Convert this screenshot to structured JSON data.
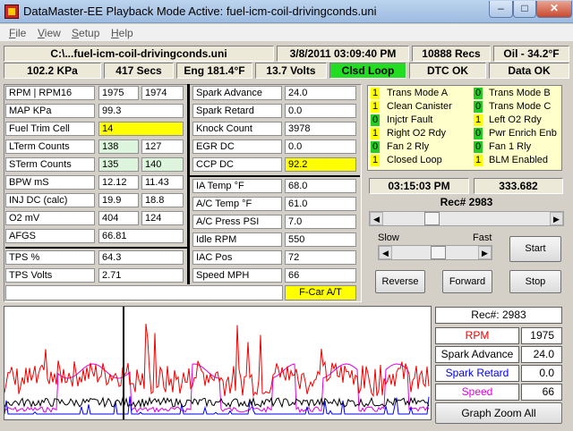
{
  "window": {
    "title": "DataMaster-EE  Playback Mode Active: fuel-icm-coil-drivingconds.uni"
  },
  "menu": [
    "File",
    "View",
    "Setup",
    "Help"
  ],
  "status_row1": {
    "file": "C:\\...fuel-icm-coil-drivingconds.uni",
    "datetime": "3/8/2011   03:09:40 PM",
    "records": "10888 Recs",
    "oil": "Oil - 34.2°F"
  },
  "status_row2": {
    "kpa": "102.2 KPa",
    "secs": "417 Secs",
    "eng": "Eng  181.4°F",
    "volts": "13.7 Volts",
    "loop": "Clsd Loop",
    "dtc": "DTC OK",
    "data": "Data OK"
  },
  "left_rows": [
    {
      "label": "RPM   |  RPM16",
      "v1": "1975",
      "v2": "1974",
      "v1_color": "white",
      "v2_color": "white"
    },
    {
      "label": "MAP KPa",
      "v1": "99.3",
      "v2": "",
      "v1_color": "white"
    },
    {
      "label": "Fuel Trim Cell",
      "v1": "14",
      "v2": "",
      "v1_color": "yellow"
    },
    {
      "label": "LTerm Counts",
      "v1": "138",
      "v2": "127",
      "v1_color": "lgreen",
      "v2_color": "white"
    },
    {
      "label": "STerm Counts",
      "v1": "135",
      "v2": "140",
      "v1_color": "lgreen",
      "v2_color": "lgreen"
    },
    {
      "label": "BPW  mS",
      "v1": "12.12",
      "v2": "11.43",
      "v1_color": "white",
      "v2_color": "white"
    },
    {
      "label": "INJ DC (calc)",
      "v1": "19.9",
      "v2": "18.8",
      "v1_color": "white",
      "v2_color": "white"
    },
    {
      "label": "O2 mV",
      "v1": "404",
      "v2": "124",
      "v1_color": "white",
      "v2_color": "white"
    },
    {
      "label": "AFGS",
      "v1": "66.81",
      "v2": "",
      "v1_color": "white"
    },
    {
      "label": "TPS %",
      "v1": "64.3",
      "v2": "",
      "v1_color": "white"
    },
    {
      "label": "TPS Volts",
      "v1": "2.71",
      "v2": "",
      "v1_color": "white"
    }
  ],
  "mid_rows": [
    {
      "label": "Spark Advance",
      "value": "24.0",
      "color": "white"
    },
    {
      "label": "Spark Retard",
      "value": "0.0",
      "color": "white"
    },
    {
      "label": "Knock Count",
      "value": "3978",
      "color": "white"
    },
    {
      "label": "EGR DC",
      "value": "0.0",
      "color": "white"
    },
    {
      "label": "CCP DC",
      "value": "92.2",
      "color": "yellow"
    },
    {
      "label": "IA Temp °F",
      "value": "68.0",
      "color": "white"
    },
    {
      "label": "A/C Temp °F",
      "value": "61.0",
      "color": "white"
    },
    {
      "label": "A/C Press PSI",
      "value": "7.0",
      "color": "white"
    },
    {
      "label": "Idle RPM",
      "value": "550",
      "color": "white"
    },
    {
      "label": "IAC Pos",
      "value": "72",
      "color": "white"
    },
    {
      "label": "Speed MPH",
      "value": "66",
      "color": "white"
    }
  ],
  "car_type": "F-Car A/T",
  "flags_left": [
    {
      "state": "1",
      "label": "Trans Mode A"
    },
    {
      "state": "1",
      "label": "Clean Canister"
    },
    {
      "state": "0",
      "label": "Injctr Fault"
    },
    {
      "state": "1",
      "label": "Right O2 Rdy"
    },
    {
      "state": "0",
      "label": "Fan 2 Rly"
    },
    {
      "state": "1",
      "label": "Closed Loop"
    }
  ],
  "flags_right": [
    {
      "state": "0",
      "label": "Trans Mode B"
    },
    {
      "state": "0",
      "label": "Trans Mode C"
    },
    {
      "state": "1",
      "label": "Left O2 Rdy"
    },
    {
      "state": "0",
      "label": "Pwr Enrich Enb"
    },
    {
      "state": "0",
      "label": "Fan 1 Rly"
    },
    {
      "state": "1",
      "label": "BLM Enabled"
    }
  ],
  "playback": {
    "time": "03:15:03 PM",
    "elapsed": "333.682",
    "rec_label": "Rec# 2983",
    "slow": "Slow",
    "fast": "Fast",
    "position_fraction": 0.27,
    "speed_fraction": 0.55
  },
  "buttons": {
    "start": "Start",
    "reverse": "Reverse",
    "forward": "Forward",
    "stop": "Stop",
    "zoom": "Graph Zoom All"
  },
  "legend": {
    "rec": "Rec#:  2983",
    "items": [
      {
        "name": "RPM",
        "value": "1975",
        "color": "#ee0000"
      },
      {
        "name": "Spark Advance",
        "value": "24.0",
        "color": "#000000"
      },
      {
        "name": "Spark Retard",
        "value": "0.0",
        "color": "#0000ee"
      },
      {
        "name": "Speed",
        "value": "66",
        "color": "#dd00dd"
      }
    ]
  },
  "colors": {
    "flag_on": "#ffff00",
    "flag_off": "#22cc22",
    "loop_ok": "#22dd22",
    "highlight": "#ffff00"
  }
}
